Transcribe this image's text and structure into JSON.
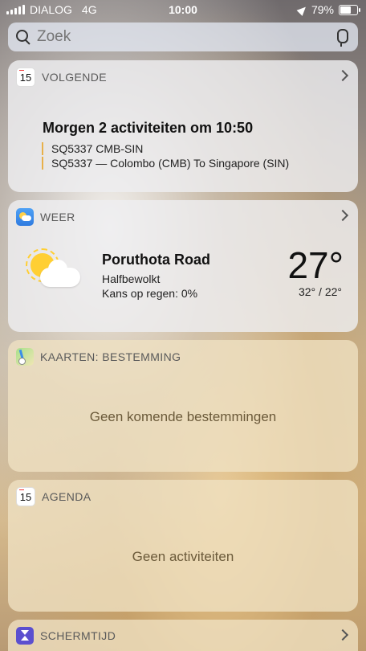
{
  "status_bar": {
    "carrier": "DIALOG",
    "network": "4G",
    "time": "10:00",
    "battery": "79%",
    "battery_level": 0.79
  },
  "search": {
    "placeholder": "Zoek"
  },
  "widgets": {
    "next": {
      "header": "VOLGENDE",
      "calendar_day": "15",
      "title": "Morgen 2 activiteiten om 10:50",
      "events": [
        "SQ5337 CMB-SIN",
        "SQ5337 — Colombo (CMB) To Singapore (SIN)"
      ]
    },
    "weather": {
      "header": "WEER",
      "location": "Poruthota Road",
      "condition": "Halfbewolkt",
      "rain_chance": "Kans op regen: 0%",
      "temperature": "27°",
      "high_low": "32° / 22°"
    },
    "maps": {
      "header": "KAARTEN: BESTEMMING",
      "empty_message": "Geen komende bestemmingen"
    },
    "agenda": {
      "header": "AGENDA",
      "calendar_day": "15",
      "empty_message": "Geen activiteiten"
    },
    "screen_time": {
      "header": "SCHERMTIJD"
    }
  }
}
